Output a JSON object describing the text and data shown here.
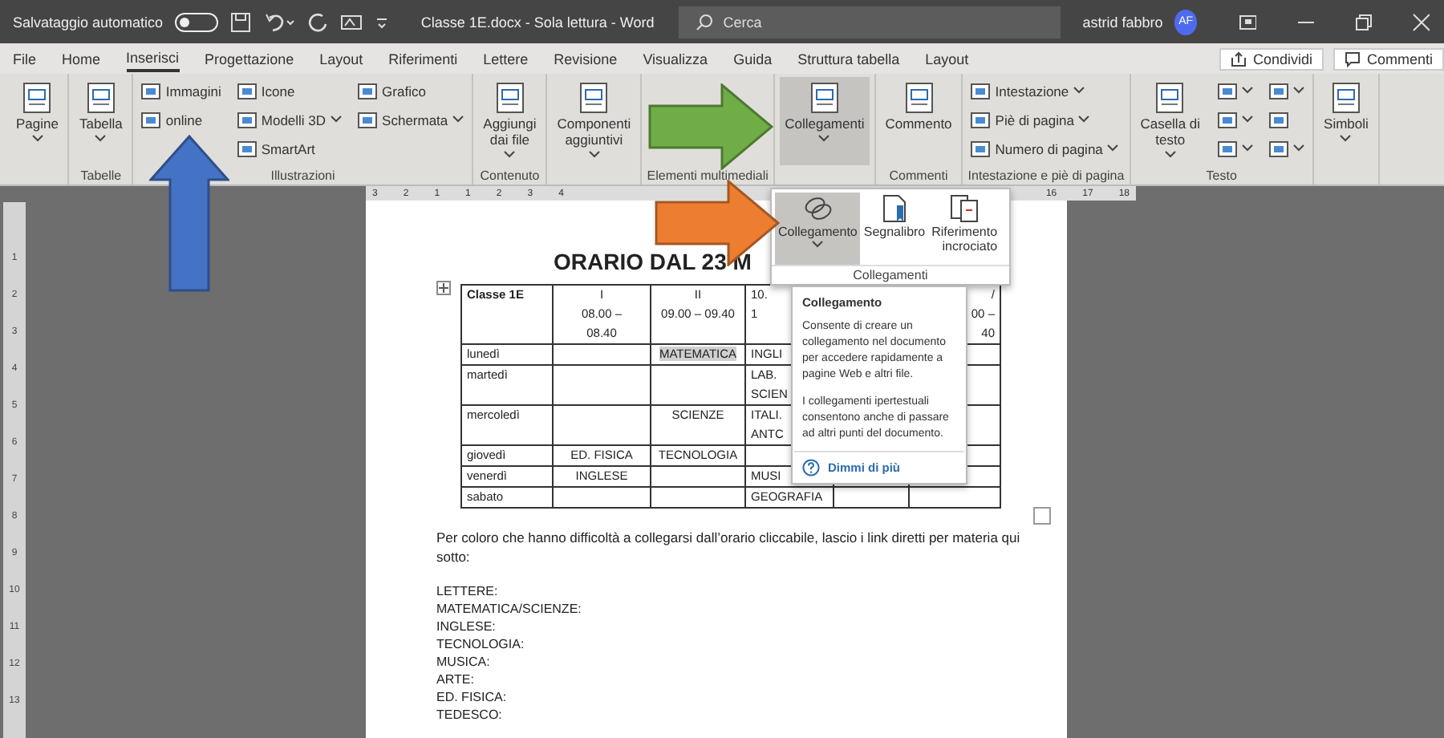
{
  "title_bar": {
    "autosave_label": "Salvataggio automatico",
    "autosave_on": false,
    "doc_title": "Classe 1E.docx - Sola lettura - Word",
    "search_placeholder": "Cerca",
    "user_name": "astrid fabbro",
    "avatar_initials": "AF"
  },
  "tabs": [
    {
      "label": "File",
      "selected": false
    },
    {
      "label": "Home",
      "selected": false
    },
    {
      "label": "Inserisci",
      "selected": true
    },
    {
      "label": "Progettazione",
      "selected": false
    },
    {
      "label": "Layout",
      "selected": false
    },
    {
      "label": "Riferimenti",
      "selected": false
    },
    {
      "label": "Lettere",
      "selected": false
    },
    {
      "label": "Revisione",
      "selected": false
    },
    {
      "label": "Visualizza",
      "selected": false
    },
    {
      "label": "Guida",
      "selected": false
    },
    {
      "label": "Struttura tabella",
      "selected": false
    },
    {
      "label": "Layout",
      "selected": false
    }
  ],
  "share_button": "Condividi",
  "comments_button": "Commenti",
  "ribbon_groups": [
    {
      "columns": [
        [
          {
            "kind": "large",
            "label": "Pagine",
            "dropdown": true,
            "pressed": false
          }
        ]
      ]
    },
    {
      "label": "Tabelle",
      "columns": [
        [
          {
            "kind": "large",
            "label": "Tabella",
            "dropdown": true,
            "pressed": false
          }
        ]
      ]
    },
    {
      "label": "Illustrazioni",
      "columns": [
        [
          {
            "kind": "small",
            "label": "Immagini",
            "dropdown": false,
            "pressed": false
          },
          {
            "kind": "small",
            "label": "online",
            "dropdown": false,
            "pressed": false
          }
        ],
        [
          {
            "kind": "small",
            "label": "Icone",
            "dropdown": false,
            "pressed": false
          },
          {
            "kind": "small",
            "label": "Modelli 3D",
            "dropdown": true,
            "pressed": false
          },
          {
            "kind": "small",
            "label": "SmartArt",
            "dropdown": false,
            "pressed": false
          }
        ],
        [
          {
            "kind": "small",
            "label": "Grafico",
            "dropdown": false,
            "pressed": false
          },
          {
            "kind": "small",
            "label": "Schermata",
            "dropdown": true,
            "pressed": false
          }
        ]
      ]
    },
    {
      "label": "Contenuto",
      "columns": [
        [
          {
            "kind": "large",
            "label": "Aggiungi\ndai file",
            "dropdown": true,
            "pressed": false
          }
        ]
      ]
    },
    {
      "columns": [
        [
          {
            "kind": "large",
            "label": "Componenti\naggiuntivi",
            "dropdown": true,
            "pressed": false
          }
        ]
      ]
    },
    {
      "label": "Elementi multimediali"
    },
    {
      "columns": [
        [
          {
            "kind": "large",
            "label": "Collegamenti",
            "dropdown": true,
            "pressed": true
          }
        ]
      ]
    },
    {
      "label": "Commenti",
      "columns": [
        [
          {
            "kind": "large",
            "label": "Commento",
            "dropdown": false,
            "pressed": false
          }
        ]
      ]
    },
    {
      "label": "Intestazione e piè di pagina",
      "columns": [
        [
          {
            "kind": "small",
            "label": "Intestazione",
            "dropdown": true,
            "pressed": false
          },
          {
            "kind": "small",
            "label": "Piè di pagina",
            "dropdown": true,
            "pressed": false
          },
          {
            "kind": "small",
            "label": "Numero di pagina",
            "dropdown": true,
            "pressed": false
          }
        ]
      ]
    },
    {
      "label": "Testo",
      "columns": [
        [
          {
            "kind": "large",
            "label": "Casella di\ntesto",
            "dropdown": true,
            "pressed": false
          }
        ],
        [
          {
            "kind": "small",
            "dropdown": true,
            "pressed": false
          },
          {
            "kind": "small",
            "dropdown": true,
            "pressed": false
          },
          {
            "kind": "small",
            "dropdown": true,
            "pressed": false
          }
        ],
        [
          {
            "kind": "small",
            "dropdown": true,
            "pressed": false
          },
          {
            "kind": "small",
            "dropdown": false,
            "pressed": false
          },
          {
            "kind": "small",
            "dropdown": true,
            "pressed": false
          }
        ]
      ]
    },
    {
      "columns": [
        [
          {
            "kind": "large",
            "label": "Simboli",
            "dropdown": true,
            "pressed": false
          }
        ]
      ]
    }
  ],
  "ruler": {
    "left_numbers": [
      "3",
      "2",
      "1",
      "1",
      "2",
      "3",
      "4"
    ],
    "right_numbers": [
      "16",
      "17",
      "18"
    ]
  },
  "vertical_ruler": [
    "1",
    "2",
    "3",
    "4",
    "5",
    "6",
    "7",
    "8",
    "9",
    "10",
    "11",
    "12",
    "13"
  ],
  "document": {
    "title": "ORARIO DAL 23 M",
    "table": {
      "header": {
        "column_1": "Classe 1E",
        "column_2": "I\n08.00 –\n08.40",
        "column_3": "II\n09.00 – 09.40",
        "column_4": "10.\n1",
        "column_6": "/\n00 –\n40"
      },
      "rows": [
        [
          {
            "text": "lunedì",
            "shaded": false
          },
          null,
          {
            "text": "MATEMATICA",
            "shaded": true
          },
          {
            "text": "INGLI",
            "shaded": false
          },
          null,
          null
        ],
        [
          {
            "text": "martedì",
            "shaded": false
          },
          null,
          null,
          {
            "text": "LAB.\nSCIEN",
            "shaded": false
          },
          null,
          null
        ],
        [
          {
            "text": "mercoledì",
            "shaded": false
          },
          null,
          {
            "text": "SCIENZE",
            "shaded": false
          },
          {
            "text": "ITALI.\nANTC",
            "shaded": false
          },
          null,
          null
        ],
        [
          {
            "text": "giovedì",
            "shaded": false
          },
          {
            "text": "ED. FISICA",
            "shaded": false
          },
          {
            "text": "TECNOLOGIA",
            "shaded": false
          },
          null,
          null,
          null
        ],
        [
          {
            "text": "venerdì",
            "shaded": false
          },
          {
            "text": "INGLESE",
            "shaded": false
          },
          null,
          {
            "text": "MUSI",
            "shaded": false
          },
          null,
          null
        ],
        [
          {
            "text": "sabato",
            "shaded": false
          },
          null,
          null,
          {
            "text": "GEOGRAFIA",
            "shaded": false
          },
          null,
          null
        ]
      ]
    },
    "paragraph": "Per coloro che hanno difficoltà a collegarsi dall’orario cliccabile, lascio i link diretti per materia qui sotto:",
    "lines": [
      "LETTERE:",
      "MATEMATICA/SCIENZE:",
      "INGLESE:",
      "TECNOLOGIA:",
      "MUSICA:",
      "ARTE:",
      "ED. FISICA:",
      "TEDESCO:"
    ]
  },
  "links_dropdown": {
    "items": [
      {
        "label": "Collegamento",
        "selected": true,
        "dropdown": true
      },
      {
        "label": "Segnalibro",
        "selected": false,
        "dropdown": false
      },
      {
        "label": "Riferimento\nincrociato",
        "selected": false,
        "dropdown": false
      }
    ],
    "group_label": "Collegamenti"
  },
  "tooltip": {
    "title": "Collegamento",
    "paragraphs": [
      "Consente di creare un collegamento nel documento per accedere rapidamente a pagine Web e altri file.",
      "I collegamenti ipertestuali consentono anche di passare ad altri punti del documento."
    ],
    "link": "Dimmi di più"
  },
  "annotations": [
    {
      "kind": "up-arrow",
      "color": "#4472c4"
    },
    {
      "kind": "right-arrow",
      "color": "#70ad47"
    },
    {
      "kind": "right-arrow",
      "color": "#ed7d31"
    }
  ]
}
